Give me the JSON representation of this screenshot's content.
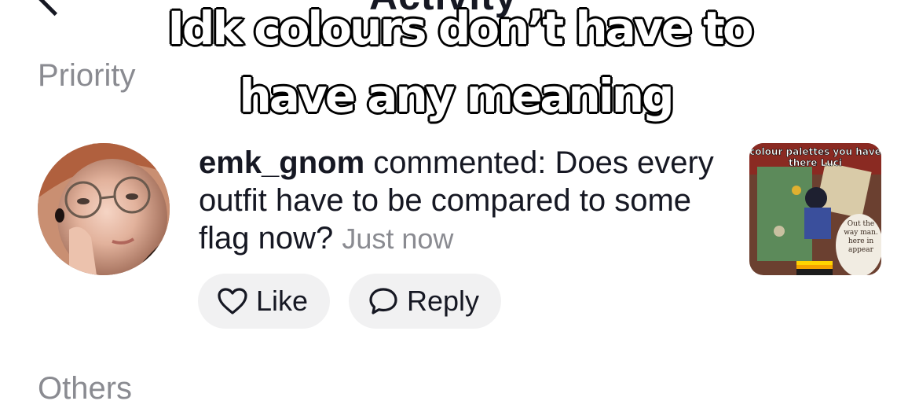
{
  "header": {
    "title_clipped": "Activity"
  },
  "caption": {
    "line1": "Idk colours don’t have to",
    "line2": "have any meaning"
  },
  "sections": {
    "priority": "Priority",
    "others": "Others"
  },
  "comment": {
    "username": "emk_gnom",
    "action": " commented: Does every outfit have to be compared to some flag now? ",
    "timestamp": "Just now",
    "like_label": "Like",
    "reply_label": "Reply"
  },
  "thumbnail": {
    "caption": "colour palettes you have there Luci",
    "speech_text": "Out the way man. here in appear"
  },
  "icons": {
    "back": "chevron-left-icon",
    "like": "heart-outline-icon",
    "reply": "speech-bubble-icon"
  },
  "colors": {
    "text_primary": "#161823",
    "text_secondary": "#8a8b91",
    "pill_bg": "#f1f1f2",
    "background": "#ffffff"
  }
}
